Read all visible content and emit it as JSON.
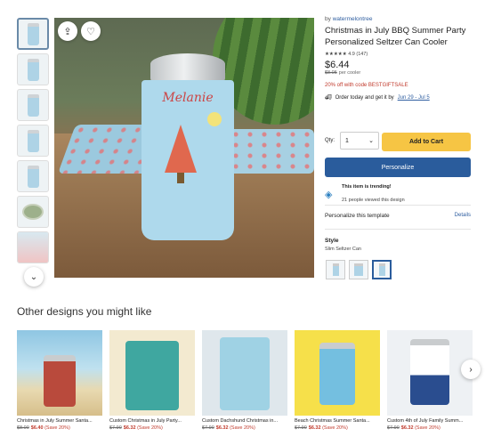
{
  "product": {
    "by_prefix": "by",
    "seller": "watermelontree",
    "title": "Christmas in July BBQ Summer Party Personalized Seltzer Can Cooler",
    "rating_stars": "★★★★★",
    "rating_value": "4.9 (147)",
    "price": "$6.44",
    "old_price": "$8.05",
    "unit": "per cooler",
    "promo": "20% off with code BESTGIFTSALE",
    "ship_prefix": "Order today and get it by",
    "ship_date": "Jun 29 - Jul 5",
    "can_name": "Melanie"
  },
  "purchase": {
    "qty_label": "Qty:",
    "qty_value": "1",
    "add_to_cart": "Add to Cart",
    "personalize": "Personalize"
  },
  "trending": {
    "title": "This item is trending!",
    "subtitle": "21 people viewed this design"
  },
  "personalize_section": {
    "label": "Personalize this template",
    "details_link": "Details"
  },
  "style": {
    "label": "Style",
    "value": "Slim Seltzer Can"
  },
  "recommendations": {
    "title": "Other designs you might like",
    "items": [
      {
        "name": "Christmas in July Summer Santa...",
        "old_price": "$8.00",
        "price": "$6.40",
        "save": "(Save 20%)"
      },
      {
        "name": "Custom Christmas in July Party...",
        "old_price": "$7.90",
        "price": "$6.32",
        "save": "(Save 20%)"
      },
      {
        "name": "Custom Dachshund Christmas in...",
        "old_price": "$7.90",
        "price": "$6.32",
        "save": "(Save 20%)"
      },
      {
        "name": "Beach Christmas Summer Santa...",
        "old_price": "$7.90",
        "price": "$6.32",
        "save": "(Save 20%)"
      },
      {
        "name": "Custom 4th of July Family Summ...",
        "old_price": "$7.90",
        "price": "$6.32",
        "save": "(Save 20%)"
      }
    ]
  },
  "colors": {
    "accent_blue": "#2a5c9c",
    "cart_yellow": "#f6c544",
    "sale_red": "#c0392b",
    "link_blue": "#2f5ea0"
  }
}
